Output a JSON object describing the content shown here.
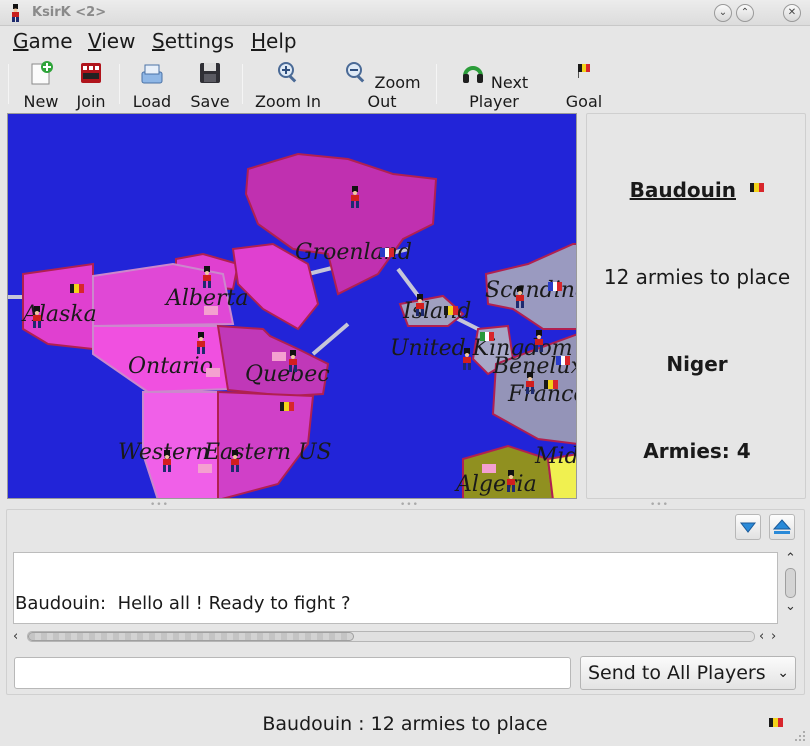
{
  "window": {
    "title": "KsirK <2>",
    "minimize_glyph": "⌄",
    "close_glyph": "✕",
    "icon": "soldier-icon"
  },
  "menu": [
    {
      "first": "G",
      "rest": "ame"
    },
    {
      "first": "V",
      "rest": "iew"
    },
    {
      "first": "S",
      "rest": "ettings"
    },
    {
      "first": "H",
      "rest": "elp"
    }
  ],
  "toolbar": {
    "new": "New",
    "join": "Join",
    "load": "Load",
    "save": "Save",
    "zoom_in": "Zoom In",
    "zoom_out": "Zoom Out",
    "next_player": "Next Player",
    "goal": "Goal"
  },
  "map": {
    "ocean_color": "#2224d8",
    "countries": {
      "alaska": "Alaska",
      "alberta": "Alberta",
      "groenland": "Groenland",
      "ontario": "Ontario",
      "quebec": "Quebec",
      "western_us": "Western",
      "eastern_us": "Eastern US",
      "islande": "Island",
      "scandinavie": "Scandina",
      "united_kingdom": "United Kingdom",
      "benelux": "Benelux",
      "france": "France",
      "algeria": "Algeria",
      "mid": "Mid"
    }
  },
  "side_panel": {
    "player": "Baudouin",
    "armies_to_place": "12 armies to place",
    "country": "Niger",
    "armies": "Armies: 4"
  },
  "chat": {
    "sender": "Baudouin:",
    "message": "Hello all ! Ready to fight ?",
    "input_value": "",
    "recipient": "Send to All Players"
  },
  "status": {
    "text": "Baudouin : 12 armies to place"
  },
  "colors": {
    "belgium_black": "#1a1a1a",
    "belgium_yellow": "#f2d31a",
    "belgium_red": "#d8262c"
  }
}
